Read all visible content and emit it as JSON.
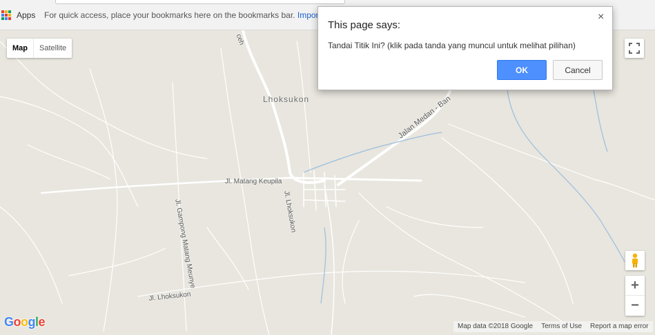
{
  "browser": {
    "bookmarks_bar": {
      "apps_label": "Apps",
      "hint_text": "For quick access, place your bookmarks here on the bookmarks bar.",
      "import_link": "Import"
    },
    "apps_icon_colors": [
      "#e33d2e",
      "#f4b400",
      "#0f9d58",
      "#4285f4",
      "#e33d2e",
      "#f4b400",
      "#0f9d58",
      "#4285f4",
      "#e33d2e"
    ]
  },
  "map": {
    "map_type": {
      "map_label": "Map",
      "satellite_label": "Satellite",
      "selected": "Map"
    },
    "labels": {
      "town": "Lhoksukon",
      "road_medan": "Jalan Medan - Ban",
      "road_matang": "Jl. Matang Keupila",
      "road_lhoksukon_vertical": "Jl. Lhoksukon",
      "road_gampong": "Jl. Gampong Matang Meunye",
      "road_lhoksukon_south": "Jl. Lhoksukon",
      "road_top": "ceh"
    },
    "controls": {
      "fullscreen_icon": "fullscreen-icon",
      "pegman_icon": "pegman-icon",
      "zoom_in": "+",
      "zoom_out": "−"
    },
    "google_logo": [
      "G",
      "o",
      "o",
      "g",
      "l",
      "e"
    ],
    "google_colors": [
      "#4285f4",
      "#ea4335",
      "#fbbc05",
      "#4285f4",
      "#34a853",
      "#ea4335"
    ],
    "attribution": {
      "data": "Map data ©2018 Google",
      "terms": "Terms of Use",
      "report": "Report a map error"
    }
  },
  "dialog": {
    "title": "This page says:",
    "message": "Tandai Titik Ini? (klik pada tanda yang muncul untuk melihat pilihan)",
    "ok_label": "OK",
    "cancel_label": "Cancel",
    "close_icon": "×"
  }
}
